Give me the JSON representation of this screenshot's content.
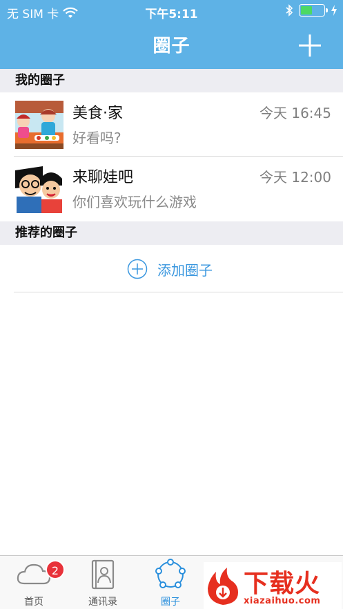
{
  "status_bar": {
    "carrier": "无 SIM 卡",
    "time": "下午5:11",
    "battery_level": 0.5
  },
  "nav": {
    "title": "圈子",
    "add_icon": "plus-icon"
  },
  "sections": {
    "mine_title": "我的圈子",
    "recommended_title": "推荐的圈子"
  },
  "circles": [
    {
      "name": "美食·家",
      "time": "今天 16:45",
      "last_message": "好看吗?"
    },
    {
      "name": "来聊娃吧",
      "time": "今天 12:00",
      "last_message": "你们喜欢玩什么游戏"
    }
  ],
  "add_circle": {
    "label": "添加圈子",
    "icon": "plus-circle-icon"
  },
  "tabbar": {
    "tabs": [
      {
        "label": "首页",
        "icon": "cloud-icon",
        "badge": "2"
      },
      {
        "label": "通讯录",
        "icon": "contacts-book-icon"
      },
      {
        "label": "圈子",
        "icon": "circle-ring-icon",
        "active": true
      }
    ]
  },
  "watermark": {
    "title": "下载火",
    "subtitle": "xiazaihuo.com"
  },
  "colors": {
    "nav_bg": "#5eb2e6",
    "accent": "#3a97df",
    "badge": "#e8323a",
    "watermark": "#e62f1f"
  }
}
